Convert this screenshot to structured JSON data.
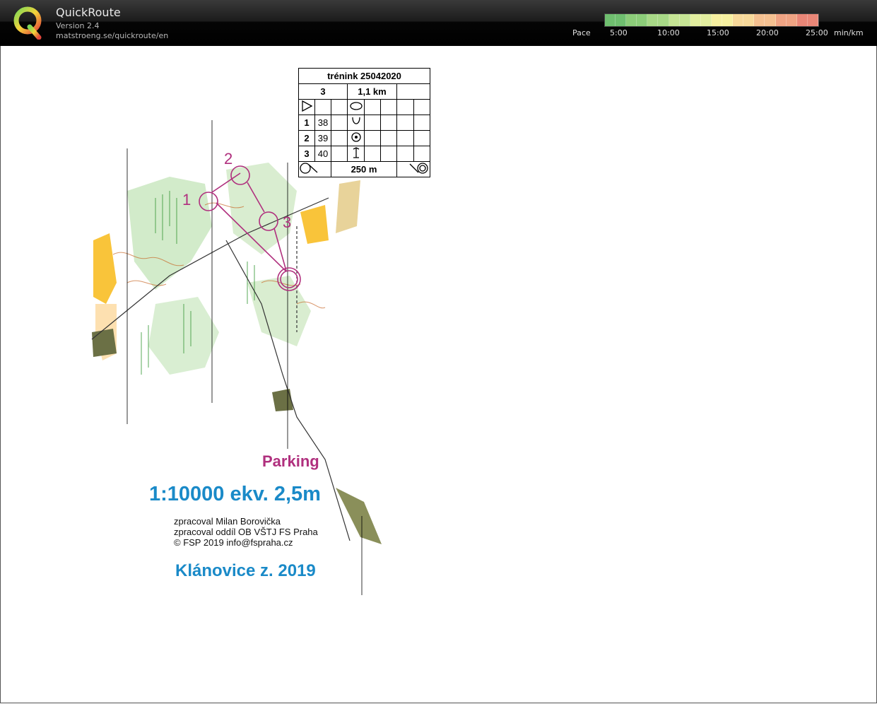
{
  "app": {
    "title": "QuickRoute",
    "version": "Version 2.4",
    "url": "matstroeng.se/quickroute/en"
  },
  "pace": {
    "label": "Pace",
    "ticks": [
      "5:00",
      "10:00",
      "15:00",
      "20:00",
      "25:00"
    ],
    "unit": "min/km",
    "colors": [
      "#6fbf6f",
      "#8ccd79",
      "#a8d987",
      "#c6e595",
      "#e2ee9f",
      "#f6f0a0",
      "#f7d99a",
      "#f4c090",
      "#efa383",
      "#e98677"
    ]
  },
  "control_table": {
    "title": "trénink 25042020",
    "course_number": "3",
    "length": "1,1 km",
    "rows": [
      {
        "num": "1",
        "code": "38"
      },
      {
        "num": "2",
        "code": "39"
      },
      {
        "num": "3",
        "code": "40"
      }
    ],
    "footer": "250 m"
  },
  "map": {
    "control_labels": [
      "1",
      "2",
      "3"
    ],
    "parking": "Parking",
    "scale": "1:10000 ekv. 2,5m",
    "credits": [
      "zpracoval Milan Borovička",
      "zpracoval oddíl OB VŠTJ FS Praha",
      "© FSP 2019  info@fspraha.cz"
    ],
    "name": "Klánovice z. 2019",
    "colors": {
      "course": "#b0307e",
      "brand_blue": "#1a8ac8",
      "forest_green": "#bfe3b4",
      "open_yellow": "#f9c43a"
    }
  }
}
